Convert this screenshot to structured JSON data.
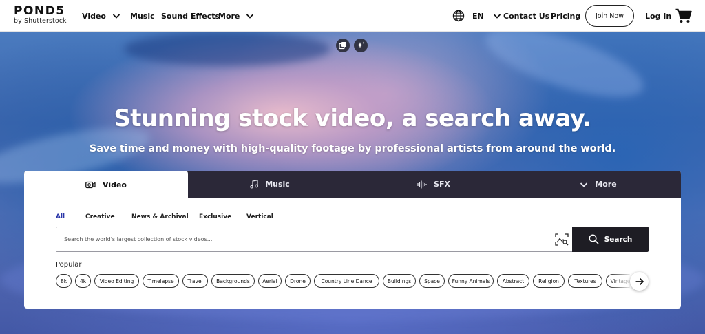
{
  "nav": {
    "logo": {
      "main": "POND5",
      "sub": "by Shutterstock"
    },
    "items": [
      {
        "label": "Video",
        "has_dropdown": true
      },
      {
        "label": "Music",
        "has_dropdown": false
      },
      {
        "label": "Sound Effects",
        "has_dropdown": false
      },
      {
        "label": "More",
        "has_dropdown": true
      }
    ],
    "language": {
      "icon": "globe-icon",
      "label": "EN"
    },
    "contact_label": "Contact Us",
    "pricing_label": "Pricing",
    "join_label": "Join Now",
    "login_label": "Log In",
    "cart_icon": "cart-icon"
  },
  "hero": {
    "tools": [
      "copy-icon",
      "sparkle-icon"
    ],
    "headline": "Stunning stock video, a search away.",
    "subheadline": "Save time and money with high-quality footage by professional artists from around the world."
  },
  "search": {
    "tabs": [
      {
        "label": "Video",
        "icon": "video-camera-icon",
        "active": true
      },
      {
        "label": "Music",
        "icon": "music-note-icon",
        "active": false
      },
      {
        "label": "SFX",
        "icon": "waveform-icon",
        "active": false
      },
      {
        "label": "More",
        "icon": "chevron-down-icon",
        "active": false
      }
    ],
    "filters": [
      {
        "label": "All",
        "active": true
      },
      {
        "label": "Creative",
        "active": false
      },
      {
        "label": "News & Archival",
        "active": false
      },
      {
        "label": "Exclusive",
        "active": false
      },
      {
        "label": "Vertical",
        "active": false
      }
    ],
    "placeholder": "Search the world's largest collection of stock videos...",
    "value": "",
    "visual_search_icon": "image-search-icon",
    "button_label": "Search",
    "popular_label": "Popular",
    "popular": [
      "8k",
      "4k",
      "Video Editing",
      "Timelapse",
      "Travel",
      "Backgrounds",
      "Aerial",
      "Drone",
      "Country Line Dance",
      "Buildings",
      "Space",
      "Funny Animals",
      "Abstract",
      "Religion",
      "Textures",
      "Vintage"
    ],
    "next_icon": "arrow-right-icon"
  },
  "colors": {
    "tab_bar": "#2b2838",
    "search_button": "#1e1d24",
    "active_filter": "#2a36a8"
  }
}
